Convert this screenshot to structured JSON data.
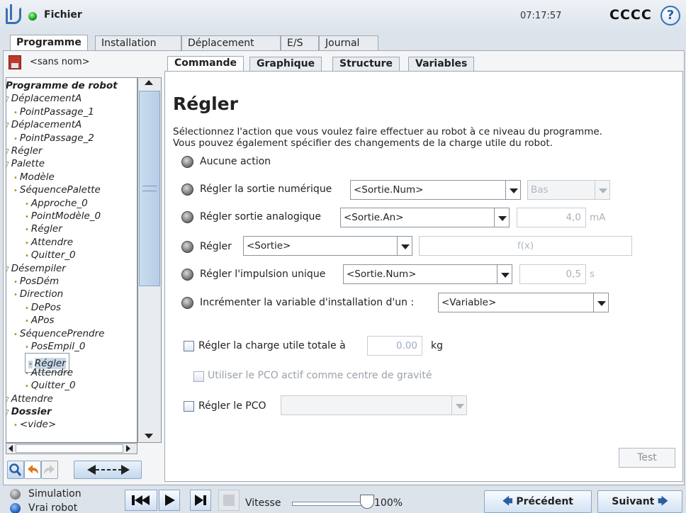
{
  "header": {
    "file_menu": "Fichier",
    "clock": "07:17:57",
    "robot_name": "CCCC",
    "help_glyph": "?"
  },
  "main_tabs": [
    "Programme",
    "Installation",
    "Déplacement",
    "E/S",
    "Journal"
  ],
  "program": {
    "name": "<sans nom>"
  },
  "tree": [
    {
      "label": "Programme de robot",
      "depth": 0,
      "bold": true
    },
    {
      "label": "DéplacementA",
      "depth": 1
    },
    {
      "label": "PointPassage_1",
      "depth": 2
    },
    {
      "label": "DéplacementA",
      "depth": 1
    },
    {
      "label": "PointPassage_2",
      "depth": 2
    },
    {
      "label": "Régler",
      "depth": 1
    },
    {
      "label": "Palette",
      "depth": 1
    },
    {
      "label": "Modèle",
      "depth": 2
    },
    {
      "label": "SéquencePalette",
      "depth": 2
    },
    {
      "label": "Approche_0",
      "depth": 3
    },
    {
      "label": "PointModèle_0",
      "depth": 3
    },
    {
      "label": "Régler",
      "depth": 3
    },
    {
      "label": "Attendre",
      "depth": 3
    },
    {
      "label": "Quitter_0",
      "depth": 3
    },
    {
      "label": "Désempiler",
      "depth": 1
    },
    {
      "label": "PosDém",
      "depth": 2
    },
    {
      "label": "Direction",
      "depth": 2
    },
    {
      "label": "DePos",
      "depth": 3
    },
    {
      "label": "APos",
      "depth": 3
    },
    {
      "label": "SéquencePrendre",
      "depth": 2
    },
    {
      "label": "PosEmpil_0",
      "depth": 3
    },
    {
      "label": "Régler",
      "depth": 3,
      "selected": true
    },
    {
      "label": "Attendre",
      "depth": 3
    },
    {
      "label": "Quitter_0",
      "depth": 3
    },
    {
      "label": "Attendre",
      "depth": 1
    },
    {
      "label": "Dossier",
      "depth": 1,
      "bold": true
    },
    {
      "label": "<vide>",
      "depth": 2
    }
  ],
  "sub_tabs": [
    "Commande",
    "Graphique",
    "Structure",
    "Variables"
  ],
  "command": {
    "title": "Régler",
    "description_line1": "Sélectionnez l'action que vous voulez faire effectuer au robot à ce niveau du programme.",
    "description_line2": "Vous pouvez également spécifier des changements de la charge utile du robot.",
    "options": {
      "none": "Aucune action",
      "digital": "Régler la sortie numérique",
      "analog": "Régler sortie analogique",
      "set": "Régler",
      "pulse": "Régler l'impulsion unique",
      "increment": "Incrémenter la variable d'installation d'un :"
    },
    "digital_select": "<Sortie.Num>",
    "digital_value": "Bas",
    "analog_select": "<Sortie.An>",
    "analog_value": "4,0",
    "analog_unit": "mA",
    "set_select": "<Sortie>",
    "set_expr": "f(x)",
    "pulse_select": "<Sortie.Num>",
    "pulse_value": "0,5",
    "pulse_unit": "s",
    "increment_select": "<Variable>",
    "payload_label": "Régler la charge utile totale à",
    "payload_value": "0.00",
    "payload_unit": "kg",
    "use_tcp_label": "Utiliser le PCO actif comme centre de gravité",
    "tcp_label": "Régler le PCO",
    "test_button": "Test"
  },
  "footer": {
    "simulation": "Simulation",
    "real_robot": "Vrai robot",
    "speed_label": "Vitesse",
    "speed_value": "100%",
    "speed_fraction": 1.0,
    "prev_button": "Précédent",
    "next_button": "Suivant"
  },
  "colors": {
    "accent": "#3a6fb0",
    "selection": "#c7d7ea",
    "status_green": "#1a9a1a"
  }
}
